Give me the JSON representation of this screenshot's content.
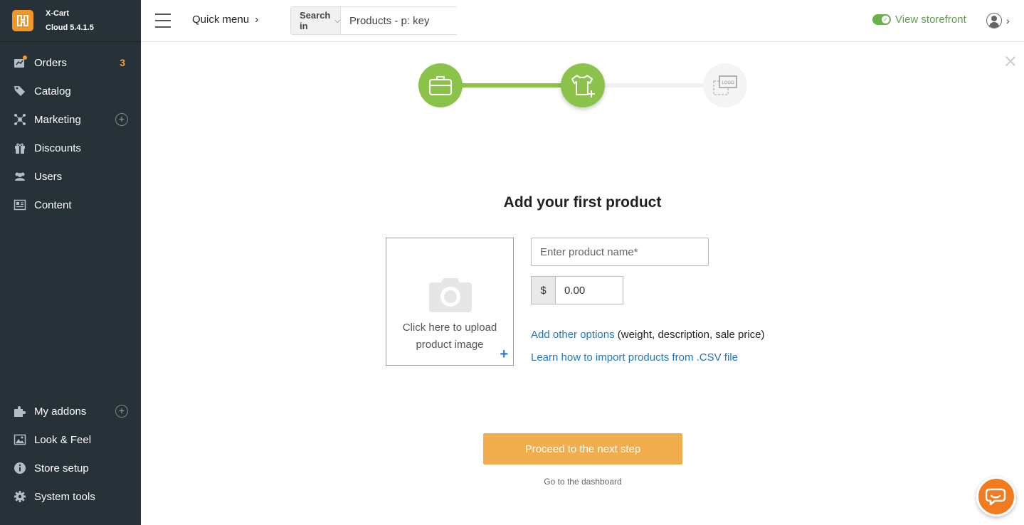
{
  "brand": {
    "name": "X-Cart",
    "version": "Cloud 5.4.1.5"
  },
  "sidebar": {
    "top_items": [
      {
        "label": "Orders",
        "icon": "orders-icon",
        "badge": "3"
      },
      {
        "label": "Catalog",
        "icon": "tag-icon"
      },
      {
        "label": "Marketing",
        "icon": "marketing-icon",
        "plus": "+"
      },
      {
        "label": "Discounts",
        "icon": "gift-icon"
      },
      {
        "label": "Users",
        "icon": "users-icon"
      },
      {
        "label": "Content",
        "icon": "content-icon"
      }
    ],
    "bottom_items": [
      {
        "label": "My addons",
        "icon": "puzzle-icon",
        "plus": "+"
      },
      {
        "label": "Look & Feel",
        "icon": "image-icon"
      },
      {
        "label": "Store setup",
        "icon": "info-icon"
      },
      {
        "label": "System tools",
        "icon": "gear-icon"
      }
    ]
  },
  "header": {
    "quick_menu": "Quick menu",
    "search_in": "Search in",
    "search_value": "Products - p: key",
    "storefront": "View storefront"
  },
  "wizard": {
    "steps": [
      {
        "icon": "briefcase-icon",
        "state": "done"
      },
      {
        "icon": "tshirt-plus-icon",
        "state": "current"
      },
      {
        "icon": "logo-upload-icon",
        "state": "pending"
      }
    ],
    "title": "Add your first product",
    "upload_text_1": "Click here to upload",
    "upload_text_2": "product image",
    "upload_plus": "+",
    "name_placeholder": "Enter product name*",
    "currency": "$",
    "price": "0.00",
    "options_link": "Add other options",
    "options_note": " (weight, description, sale price)",
    "import_link": "Learn how to import products from .CSV file",
    "proceed": "Proceed to the next step",
    "dashboard": "Go to the dashboard"
  },
  "colors": {
    "sidebar_bg": "#263238",
    "accent_orange": "#f29727",
    "step_green": "#8bc34a",
    "link_blue": "#1f78c1",
    "button_orange": "#f1ad4e"
  }
}
